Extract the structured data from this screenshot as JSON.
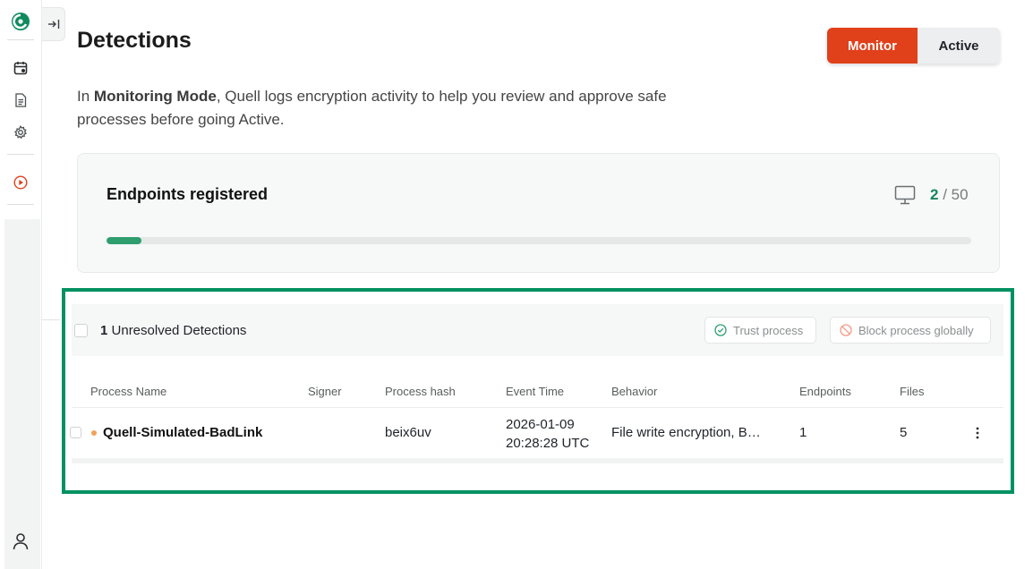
{
  "page": {
    "title": "Detections",
    "mode_toggle": {
      "monitor": "Monitor",
      "active": "Active",
      "selected": "Monitor"
    },
    "description": {
      "prefix": "In ",
      "bold": "Monitoring Mode",
      "rest": ", Quell logs encryption activity to help you review and approve safe processes before going Active."
    }
  },
  "sidebar": {
    "icons": [
      "logo-icon",
      "collapse-icon",
      "calendar-icon",
      "document-icon",
      "settings-icon",
      "play-icon",
      "user-icon"
    ]
  },
  "endpoints": {
    "title": "Endpoints registered",
    "used": "2",
    "separator": "/",
    "total": "50",
    "progress_fraction": 0.04
  },
  "detections": {
    "count": "1",
    "count_label": "Unresolved Detections",
    "actions": {
      "trust": "Trust process",
      "block": "Block process globally"
    },
    "columns": [
      "Process Name",
      "Signer",
      "Process hash",
      "Event Time",
      "Behavior",
      "Endpoints",
      "Files"
    ],
    "rows": [
      {
        "process": "Quell-Simulated-BadLink",
        "signer": "",
        "hash": "beix6uv",
        "time_date": "2026-01-09",
        "time_clock": "20:28:28 UTC",
        "behavior": "File write encryption, B…",
        "endpoints": "1",
        "files": "5"
      }
    ]
  },
  "colors": {
    "accent_red": "#e0401a",
    "brand_green": "#16845e",
    "highlight_green": "#009161",
    "progress_green": "#2e9e6e",
    "status_orange": "#f0a25a"
  }
}
